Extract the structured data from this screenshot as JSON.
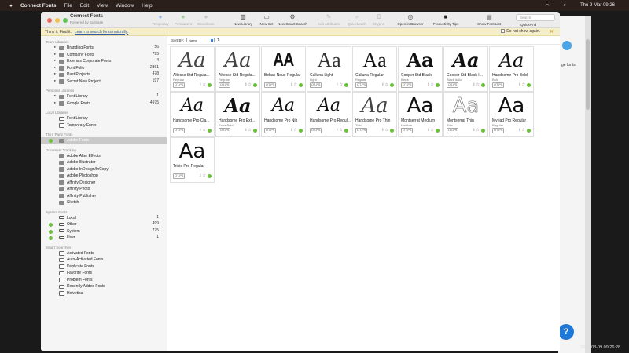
{
  "menubar": {
    "app": "Connect Fonts",
    "items": [
      "File",
      "Edit",
      "View",
      "Window",
      "Help"
    ],
    "datetime": "Thu 9 Mar  09:26"
  },
  "window": {
    "title": "Connect Fonts",
    "subtitle": "Powered by Suitcase"
  },
  "toolbar": [
    {
      "label": "Temporary",
      "icon": "circle-icon",
      "enabled": false
    },
    {
      "label": "Permanent",
      "icon": "circle-icon",
      "enabled": false
    },
    {
      "label": "Deactivate",
      "icon": "circle-icon",
      "enabled": false
    },
    {
      "label": "New Library",
      "icon": "library-icon",
      "enabled": true
    },
    {
      "label": "New Set",
      "icon": "folder-icon",
      "enabled": true
    },
    {
      "label": "New Smart Search",
      "icon": "smart-folder-icon",
      "enabled": true
    },
    {
      "label": "Edit Attributes",
      "icon": "attributes-icon",
      "enabled": false
    },
    {
      "label": "QuickMatch",
      "icon": "quickmatch-icon",
      "enabled": false
    },
    {
      "label": "Glyphs",
      "icon": "glyphs-icon",
      "enabled": false
    },
    {
      "label": "Open in Browser",
      "icon": "browser-icon",
      "enabled": true
    },
    {
      "label": "Productivity Tips",
      "icon": "tips-icon",
      "enabled": true
    },
    {
      "label": "Show Font List",
      "icon": "font-list-icon",
      "enabled": true
    }
  ],
  "search": {
    "placeholder": "Search",
    "label": "QuickFind"
  },
  "notice": {
    "text": "Think it. Find it.",
    "link": "Learn to search fonts naturally.",
    "dont_show": "Do not show again."
  },
  "sidebar": {
    "team_title": "Team Libraries",
    "team": [
      {
        "label": "Branding Fonts",
        "count": "56"
      },
      {
        "label": "Company Fonts",
        "count": "795"
      },
      {
        "label": "Extensis Corporate Fonts",
        "count": "4"
      },
      {
        "label": "Font Folio",
        "count": "2361"
      },
      {
        "label": "Past Projects",
        "count": "478"
      },
      {
        "label": "Secret New Project",
        "count": "197"
      }
    ],
    "personal_title": "Personal Libraries",
    "personal": [
      {
        "label": "Font Library",
        "count": "1"
      },
      {
        "label": "Google Fonts",
        "count": "4975"
      }
    ],
    "local_title": "Local Libraries",
    "local": [
      {
        "label": "Font Library"
      },
      {
        "label": "Temporary Fonts"
      }
    ],
    "third_title": "Third Party Fonts",
    "third": [
      {
        "label": "Adobe Fonts",
        "count": "0"
      }
    ],
    "doc_title": "Document Tracking",
    "doc": [
      {
        "label": "Adobe After Effects",
        "cls": "ad"
      },
      {
        "label": "Adobe Illustrator",
        "cls": "ai"
      },
      {
        "label": "Adobe InDesign/InCopy",
        "cls": "id"
      },
      {
        "label": "Adobe Photoshop",
        "cls": "ps"
      },
      {
        "label": "Affinity Designer",
        "cls": "af"
      },
      {
        "label": "Affinity Photo",
        "cls": "ap"
      },
      {
        "label": "Affinity Publisher",
        "cls": "apu"
      },
      {
        "label": "Sketch",
        "cls": "sk"
      }
    ],
    "system_title": "System Fonts",
    "system": [
      {
        "label": "Local",
        "count": "1",
        "dot": false
      },
      {
        "label": "Other",
        "count": "499",
        "dot": true
      },
      {
        "label": "System",
        "count": "775",
        "dot": true
      },
      {
        "label": "User",
        "count": "1",
        "dot": true
      }
    ],
    "smart_title": "Smart Searches",
    "smart": [
      {
        "label": "Activated Fonts"
      },
      {
        "label": "Auto-Activated Fonts"
      },
      {
        "label": "Duplicate Fonts"
      },
      {
        "label": "Favorite Fonts"
      },
      {
        "label": "Problem Fonts"
      },
      {
        "label": "Recently Added Fonts"
      },
      {
        "label": "Helvetica"
      }
    ]
  },
  "sortbar": {
    "label": "Sort By:",
    "value": "Name"
  },
  "fonts": [
    {
      "name": "Altesse Std Regula...",
      "sub": "Regular",
      "tag": "OT-PS",
      "sample": "Aa",
      "style": "script-thin"
    },
    {
      "name": "Altesse Std Regula...",
      "sub": "Regular",
      "tag": "OT-PS",
      "sample": "Aa",
      "style": "script-thin"
    },
    {
      "name": "Bebas Neue Regular",
      "sub": "",
      "tag": "OT-PS",
      "sample": "AA",
      "style": "condensed"
    },
    {
      "name": "Calluna Light",
      "sub": "Light",
      "tag": "OT-PS",
      "sample": "Aa",
      "style": "serif-light"
    },
    {
      "name": "Calluna Regular",
      "sub": "Regular",
      "tag": "OT-PS",
      "sample": "Aa",
      "style": "serif"
    },
    {
      "name": "Cooper Std Black",
      "sub": "Black",
      "tag": "OT-PS",
      "sample": "Aa",
      "style": "black"
    },
    {
      "name": "Cooper Std Black I...",
      "sub": "Black Italic",
      "tag": "OT-PS",
      "sample": "Aa",
      "style": "black-italic"
    },
    {
      "name": "Handsome Pro Bold",
      "sub": "Bold",
      "tag": "OT-PS",
      "sample": "Aa",
      "style": "script-bold"
    },
    {
      "name": "Handsome Pro Cla...",
      "sub": "",
      "tag": "OT-PS",
      "sample": "Aa",
      "style": "script"
    },
    {
      "name": "Handsome Pro Ext...",
      "sub": "Extra Bold",
      "tag": "OT-PS",
      "sample": "Aa",
      "style": "script-xbold"
    },
    {
      "name": "Handsome Pro Nib",
      "sub": "",
      "tag": "OT-PS",
      "sample": "Aa",
      "style": "script"
    },
    {
      "name": "Handsome Pro Regul...",
      "sub": "",
      "tag": "OT-PS",
      "sample": "Aa",
      "style": "script"
    },
    {
      "name": "Handsome Pro Thin",
      "sub": "Thin",
      "tag": "OT-PS",
      "sample": "Aa",
      "style": "script-thin"
    },
    {
      "name": "Montserrat Medium",
      "sub": "Medium",
      "tag": "OT-PS",
      "sample": "Aa",
      "style": "sans"
    },
    {
      "name": "Montserrat Thin",
      "sub": "Thin",
      "tag": "OT-PS",
      "sample": "Aa",
      "style": "sans-thin"
    },
    {
      "name": "Myriad Pro Regular",
      "sub": "Regular",
      "tag": "OT-PS",
      "sample": "Aa",
      "style": "sans"
    },
    {
      "name": "Trixie Pro Regular",
      "sub": "",
      "tag": "OT-PS",
      "sample": "Aa",
      "style": "sans"
    }
  ],
  "card_icons": {
    "info": "i",
    "fav": "☆",
    "status": "active"
  },
  "background": {
    "bg_text": "ge fonts",
    "help": "?",
    "timestamp": "2023-03-09 09:26:28"
  }
}
